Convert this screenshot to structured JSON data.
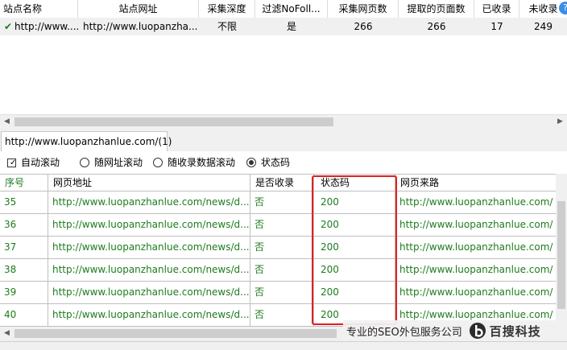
{
  "top_table": {
    "headers": [
      "站点名称",
      "站点网址",
      "采集深度",
      "过滤NoFoll...",
      "采集网页数",
      "提取的页面数",
      "已收录",
      "未收录"
    ],
    "row": {
      "check": "✔",
      "name": "http://www....",
      "url": "http://www.luopanzha...",
      "depth": "不限",
      "nofollow": "是",
      "collected": "266",
      "extracted": "266",
      "indexed": "17",
      "not_indexed": "249"
    },
    "help": "?"
  },
  "tab": {
    "label": "http://www.luopanzhanlue.com/(1)"
  },
  "options": {
    "auto_scroll": "自动滚动",
    "follow_url": "随网址滚动",
    "follow_index": "随收录数据滚动",
    "status_code": "状态码"
  },
  "bottom_table": {
    "headers": [
      "序号",
      "网页地址",
      "是否收录",
      "状态码",
      "网页来路"
    ],
    "rows": [
      {
        "no": "35",
        "url": "http://www.luopanzhanlue.com/news/d...",
        "indexed": "否",
        "status": "200",
        "referrer": "http://www.luopanzhanlue.com/"
      },
      {
        "no": "36",
        "url": "http://www.luopanzhanlue.com/news/d...",
        "indexed": "否",
        "status": "200",
        "referrer": "http://www.luopanzhanlue.com/"
      },
      {
        "no": "37",
        "url": "http://www.luopanzhanlue.com/news/d...",
        "indexed": "否",
        "status": "200",
        "referrer": "http://www.luopanzhanlue.com/"
      },
      {
        "no": "38",
        "url": "http://www.luopanzhanlue.com/news/d...",
        "indexed": "否",
        "status": "200",
        "referrer": "http://www.luopanzhanlue.com/"
      },
      {
        "no": "39",
        "url": "http://www.luopanzhanlue.com/news/d...",
        "indexed": "否",
        "status": "200",
        "referrer": "http://www.luopanzhanlue.com/"
      },
      {
        "no": "40",
        "url": "http://www.luopanzhanlue.com/news/d...",
        "indexed": "否",
        "status": "200",
        "referrer": "http://www.luopanzhanlue.com/"
      }
    ]
  },
  "watermark": {
    "text": "专业的SEO外包服务公司",
    "brand": "百搜科技"
  },
  "colors": {
    "row_text": "#1e7b1e",
    "highlight": "#e02020",
    "accent": "#3a8ee6"
  }
}
